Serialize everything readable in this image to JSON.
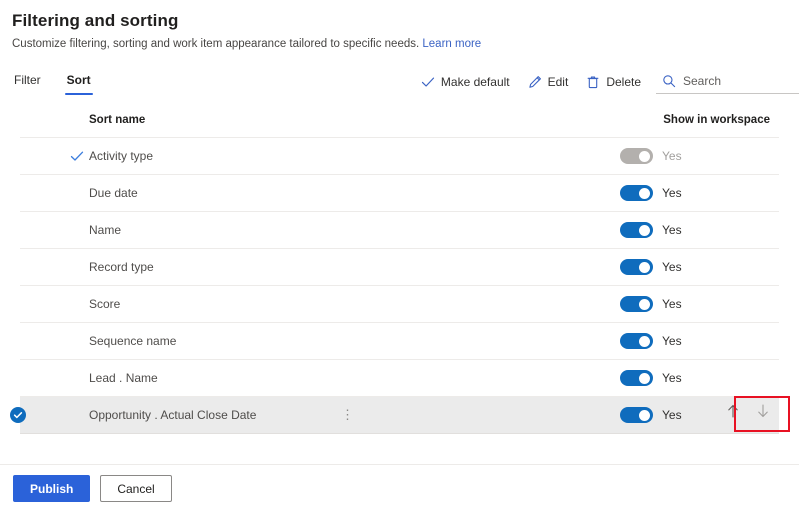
{
  "header": {
    "title": "Filtering and sorting",
    "subtitle": "Customize filtering, sorting and work item appearance tailored to specific needs.",
    "learn_more": "Learn more"
  },
  "tabs": [
    {
      "label": "Filter",
      "active": false
    },
    {
      "label": "Sort",
      "active": true
    }
  ],
  "commandbar": {
    "make_default": "Make default",
    "edit": "Edit",
    "delete": "Delete",
    "search_placeholder": "Search",
    "search_value": ""
  },
  "table": {
    "columns": {
      "sort_name": "Sort name",
      "show_in_workspace": "Show in workspace"
    },
    "rows": [
      {
        "name": "Activity type",
        "is_default": true,
        "selected": false,
        "toggle_on": false,
        "toggle_disabled": true,
        "toggle_label": "Yes",
        "overflow": ""
      },
      {
        "name": "Due date",
        "is_default": false,
        "selected": false,
        "toggle_on": true,
        "toggle_disabled": false,
        "toggle_label": "Yes",
        "overflow": ""
      },
      {
        "name": "Name",
        "is_default": false,
        "selected": false,
        "toggle_on": true,
        "toggle_disabled": false,
        "toggle_label": "Yes",
        "overflow": ""
      },
      {
        "name": "Record type",
        "is_default": false,
        "selected": false,
        "toggle_on": true,
        "toggle_disabled": false,
        "toggle_label": "Yes",
        "overflow": ""
      },
      {
        "name": "Score",
        "is_default": false,
        "selected": false,
        "toggle_on": true,
        "toggle_disabled": false,
        "toggle_label": "Yes",
        "overflow": ""
      },
      {
        "name": "Sequence name",
        "is_default": false,
        "selected": false,
        "toggle_on": true,
        "toggle_disabled": false,
        "toggle_label": "Yes",
        "overflow": ""
      },
      {
        "name": "Lead . Name",
        "is_default": false,
        "selected": false,
        "toggle_on": true,
        "toggle_disabled": false,
        "toggle_label": "Yes",
        "overflow": ""
      },
      {
        "name": "Opportunity . Actual Close Date",
        "is_default": false,
        "selected": true,
        "toggle_on": true,
        "toggle_disabled": false,
        "toggle_label": "Yes",
        "overflow": "⋮"
      }
    ]
  },
  "reorder": {
    "move_up": "↑",
    "move_down": "↓"
  },
  "footer": {
    "publish": "Publish",
    "cancel": "Cancel"
  },
  "colors": {
    "accent": "#2b62d9",
    "toggle_on": "#0f6cbd",
    "toggle_disabled": "#b3b0ad",
    "link": "#3b63c4",
    "annotation": "#e81123",
    "selected_row": "#ebebeb"
  }
}
